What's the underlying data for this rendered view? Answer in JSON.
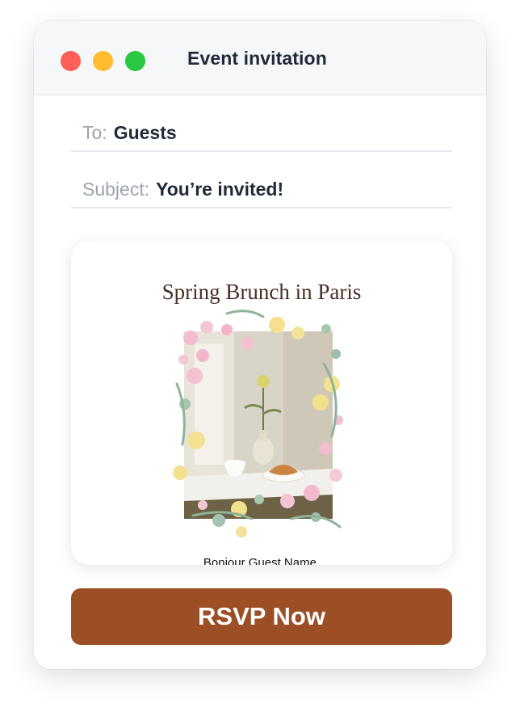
{
  "window": {
    "title": "Event invitation"
  },
  "email": {
    "to_label": "To:",
    "to_value": "Guests",
    "subject_label": "Subject:",
    "subject_value": "You’re invited!"
  },
  "card": {
    "title": "Spring Brunch in Paris",
    "greeting": "Bonjour Guest Name,"
  },
  "action": {
    "rsvp_label": "RSVP Now"
  },
  "colors": {
    "accent": "#9c4f25",
    "close": "#fe5f57",
    "minimize": "#febc2e",
    "maximize": "#28c840"
  }
}
